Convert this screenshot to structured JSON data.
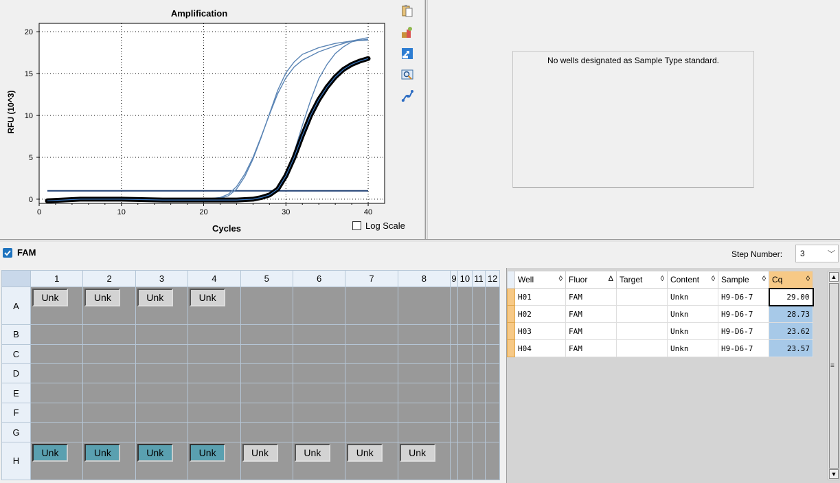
{
  "chart": {
    "title": "Amplification",
    "ylabel": "RFU (10^3)",
    "xlabel": "Cycles",
    "log_scale_label": "Log Scale",
    "log_scale_checked": false
  },
  "chart_data": {
    "type": "line",
    "title": "Amplification",
    "xlabel": "Cycles",
    "ylabel": "RFU (10^3)",
    "xlim": [
      0,
      42
    ],
    "ylim": [
      -0.5,
      21
    ],
    "xticks": [
      0,
      10,
      20,
      30,
      40
    ],
    "yticks": [
      0,
      5,
      10,
      15,
      20
    ],
    "grid": true,
    "threshold": 1.0,
    "series": [
      {
        "well": "H01",
        "color": "#000000",
        "bold": true,
        "x": [
          1,
          5,
          10,
          15,
          20,
          24,
          26,
          27,
          28,
          29,
          30,
          31,
          32,
          33,
          34,
          35,
          36,
          37,
          38,
          39,
          40
        ],
        "y": [
          -0.2,
          0,
          0,
          -0.1,
          -0.1,
          -0.1,
          0,
          0.2,
          0.5,
          1.2,
          2.8,
          5.0,
          7.6,
          10.0,
          11.9,
          13.4,
          14.6,
          15.5,
          16.1,
          16.5,
          16.8
        ]
      },
      {
        "well": "H02",
        "color": "#5b85b5",
        "bold": false,
        "x": [
          1,
          5,
          10,
          15,
          20,
          25,
          27,
          28,
          29,
          30,
          31,
          32,
          33,
          34,
          35,
          36,
          37,
          38,
          39,
          40
        ],
        "y": [
          -0.1,
          0,
          0,
          -0.1,
          -0.1,
          -0.1,
          0.1,
          0.4,
          1.2,
          3.0,
          5.6,
          8.8,
          11.8,
          14.4,
          16.1,
          17.4,
          18.2,
          18.8,
          19.0,
          19.1
        ]
      },
      {
        "well": "H03",
        "color": "#5b85b5",
        "bold": false,
        "x": [
          1,
          5,
          10,
          15,
          20,
          22,
          23,
          24,
          25,
          26,
          27,
          28,
          29,
          30,
          31,
          32,
          34,
          36,
          38,
          40
        ],
        "y": [
          0,
          0,
          0,
          0,
          0,
          0.2,
          0.6,
          1.5,
          3.0,
          5.0,
          7.5,
          10.1,
          12.6,
          14.5,
          15.8,
          16.6,
          17.6,
          18.3,
          18.9,
          19.3
        ]
      },
      {
        "well": "H04",
        "color": "#5b85b5",
        "bold": false,
        "x": [
          1,
          5,
          10,
          15,
          20,
          22,
          23,
          24,
          25,
          26,
          27,
          28,
          29,
          30,
          31,
          32,
          34,
          36,
          38,
          40
        ],
        "y": [
          0,
          0,
          0,
          0,
          0,
          0.1,
          0.4,
          1.2,
          2.7,
          4.8,
          7.4,
          10.2,
          13.0,
          15.1,
          16.4,
          17.3,
          18.1,
          18.6,
          18.9,
          19.0
        ]
      }
    ]
  },
  "standard_msg": "No wells designated as Sample Type standard.",
  "fluor": {
    "label": "FAM",
    "checked": true
  },
  "step": {
    "label": "Step Number:",
    "value": "3"
  },
  "plate": {
    "cols": [
      "1",
      "2",
      "3",
      "4",
      "5",
      "6",
      "7",
      "8",
      "9",
      "10",
      "11",
      "12"
    ],
    "rows": [
      "A",
      "B",
      "C",
      "D",
      "E",
      "F",
      "G",
      "H"
    ],
    "wells": {
      "A": [
        {
          "t": "Unk",
          "s": "sel"
        },
        {
          "t": "Unk",
          "s": "sel"
        },
        {
          "t": "Unk",
          "s": "sel"
        },
        {
          "t": "Unk",
          "s": "sel"
        }
      ],
      "H": [
        {
          "t": "Unk",
          "s": "blue"
        },
        {
          "t": "Unk",
          "s": "blue"
        },
        {
          "t": "Unk",
          "s": "blue"
        },
        {
          "t": "Unk",
          "s": "blue"
        },
        {
          "t": "Unk",
          "s": "sel"
        },
        {
          "t": "Unk",
          "s": "sel"
        },
        {
          "t": "Unk",
          "s": "sel"
        },
        {
          "t": "Unk",
          "s": "sel"
        }
      ]
    }
  },
  "results": {
    "columns": [
      {
        "label": "Well",
        "sort": "◊",
        "w": 74
      },
      {
        "label": "Fluor",
        "sort": "Δ",
        "w": 74
      },
      {
        "label": "Target",
        "sort": "◊",
        "w": 74
      },
      {
        "label": "Content",
        "sort": "◊",
        "w": 74
      },
      {
        "label": "Sample",
        "sort": "◊",
        "w": 74
      },
      {
        "label": "Cq",
        "sort": "◊",
        "w": 64
      }
    ],
    "rows": [
      [
        "H01",
        "FAM",
        "",
        "Unkn",
        "H9-D6-7",
        "29.00"
      ],
      [
        "H02",
        "FAM",
        "",
        "Unkn",
        "H9-D6-7",
        "28.73"
      ],
      [
        "H03",
        "FAM",
        "",
        "Unkn",
        "H9-D6-7",
        "23.62"
      ],
      [
        "H04",
        "FAM",
        "",
        "Unkn",
        "H9-D6-7",
        "23.57"
      ]
    ]
  }
}
